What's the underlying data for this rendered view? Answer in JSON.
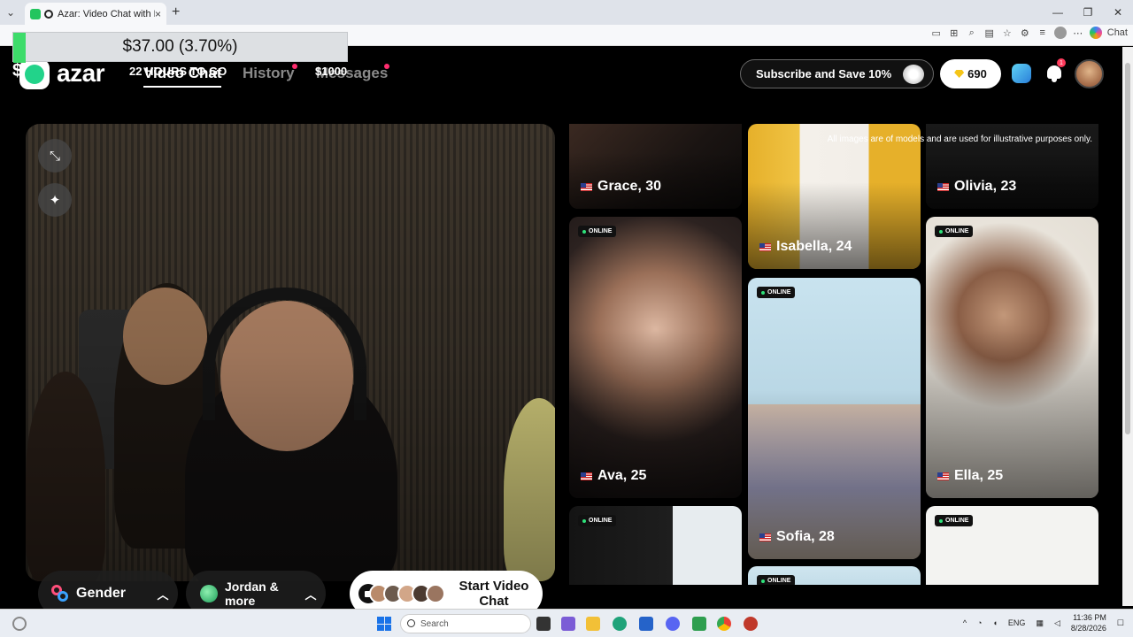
{
  "browser": {
    "tab_title": "Azar: Video Chat with New Pe",
    "tab_close": "×",
    "new_tab": "+",
    "copilot_label": "Chat",
    "window_controls": [
      "—",
      "❐",
      "✕"
    ]
  },
  "overlay": {
    "price": "$37.00 (3.70%)",
    "timer": "22 HOURS TO GO",
    "goal": "$1000",
    "dollar": "$"
  },
  "header": {
    "logo_text": "azar",
    "nav": {
      "video_chat": "Video Chat",
      "history": "History",
      "messages": "Messages"
    },
    "subscribe_label": "Subscribe and Save 10%",
    "gems_count": "690",
    "notification_badge": "1"
  },
  "video_panel": {
    "gender_label": "Gender",
    "region_label": "Jordan & more",
    "start_label": "Start Video Chat",
    "chevron": "︿"
  },
  "gallery": {
    "disclaimer": "All images are of models and are used for illustrative purposes only.",
    "online_label": "ONLINE",
    "cards": [
      {
        "name": "Grace, 30"
      },
      {
        "name": "Ava, 25"
      },
      {
        "name": "Isabella, 24"
      },
      {
        "name": "Sofia, 28"
      },
      {
        "name": "Olivia, 23"
      },
      {
        "name": "Ella, 25"
      }
    ]
  },
  "taskbar": {
    "search_placeholder": "Search",
    "language": "ENG",
    "time": "11:36 PM",
    "date": "8/28/2026"
  },
  "colors": {
    "accent_green": "#22d38a",
    "notification_pink": "#ff2d6f",
    "gem_gold": "#f5c518"
  }
}
